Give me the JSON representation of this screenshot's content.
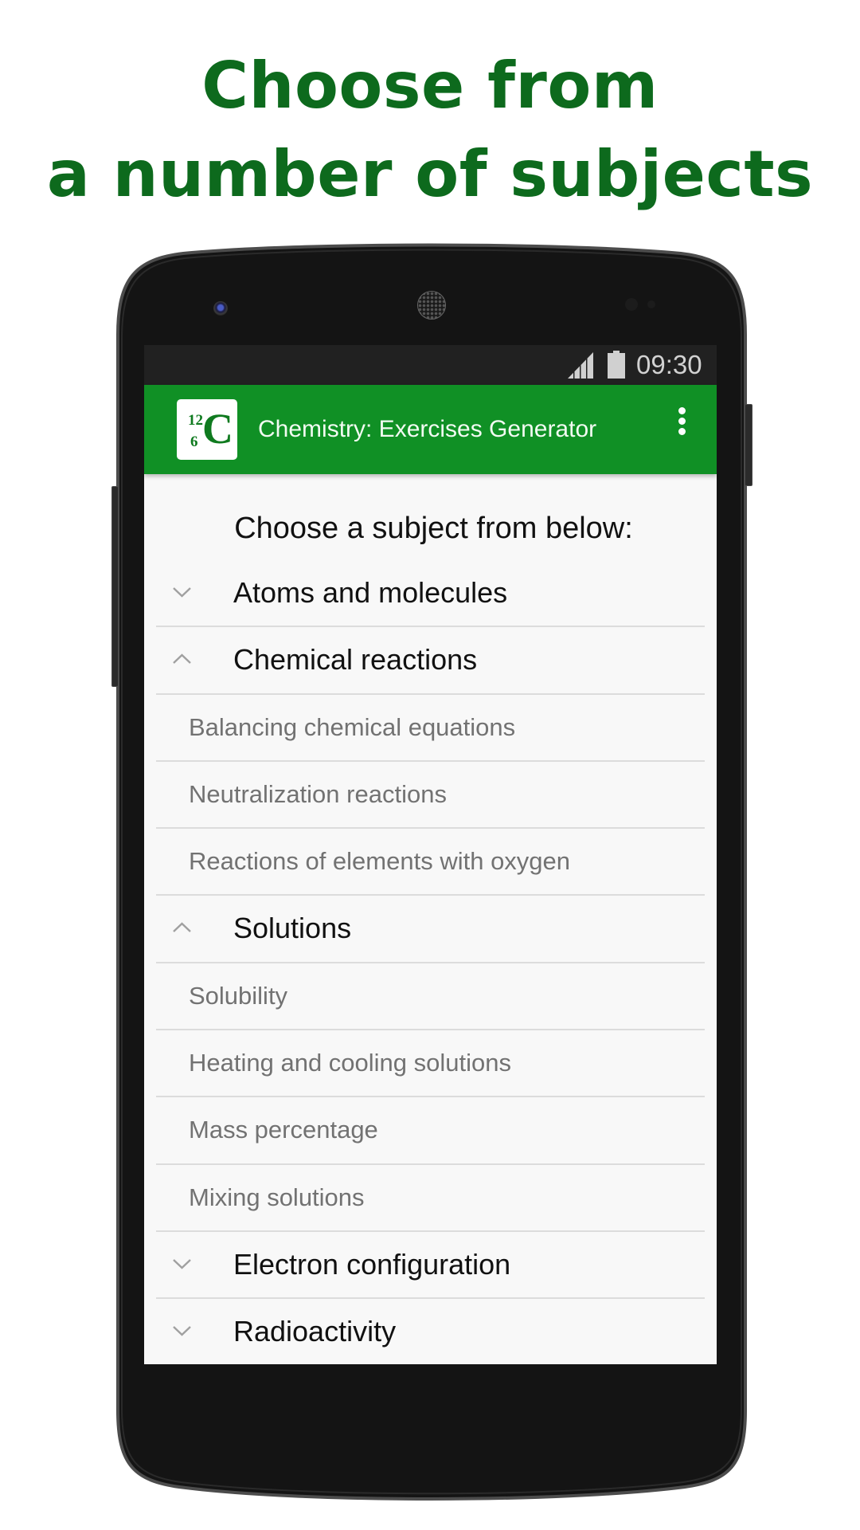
{
  "promo": {
    "headline_line1": "Choose from",
    "headline_line2": "a number of subjects",
    "headline_color": "#0d6a1d"
  },
  "status_bar": {
    "time": "09:30",
    "icons": [
      "signal-icon",
      "battery-icon"
    ]
  },
  "app_bar": {
    "icon": {
      "mass_number": "12",
      "atomic_number": "6",
      "symbol": "C"
    },
    "title": "Chemistry: Exercises Generator",
    "menu_icon": "overflow-menu-icon",
    "color": "#109025"
  },
  "main": {
    "subtitle": "Choose a subject from below:",
    "rows": [
      {
        "type": "group",
        "label": "Atoms and molecules",
        "expanded": false
      },
      {
        "type": "group",
        "label": "Chemical reactions",
        "expanded": true
      },
      {
        "type": "child",
        "label": "Balancing chemical equations"
      },
      {
        "type": "child",
        "label": "Neutralization reactions"
      },
      {
        "type": "child",
        "label": "Reactions of elements with oxygen"
      },
      {
        "type": "group",
        "label": "Solutions",
        "expanded": true
      },
      {
        "type": "child",
        "label": "Solubility"
      },
      {
        "type": "child",
        "label": "Heating and cooling solutions"
      },
      {
        "type": "child",
        "label": "Mass percentage"
      },
      {
        "type": "child",
        "label": "Mixing solutions"
      },
      {
        "type": "group",
        "label": "Electron configuration",
        "expanded": false
      },
      {
        "type": "group",
        "label": "Radioactivity",
        "expanded": false
      }
    ]
  }
}
